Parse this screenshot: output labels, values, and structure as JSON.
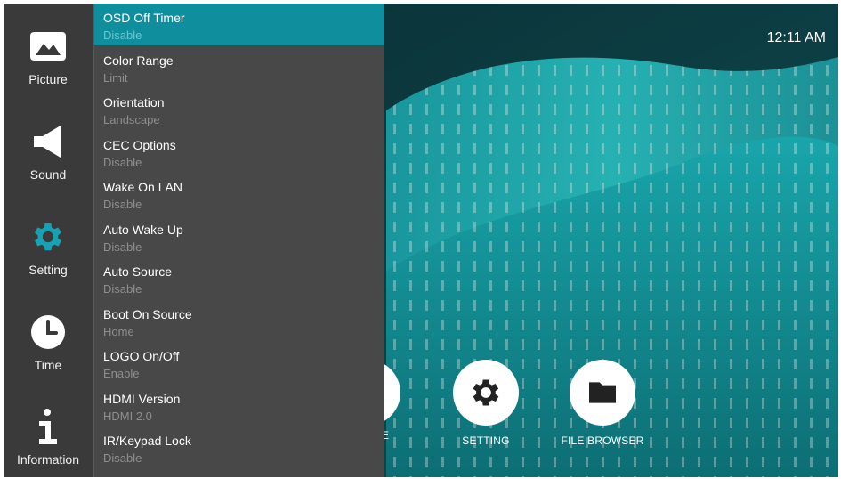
{
  "rail": {
    "items": [
      {
        "label": "Picture",
        "icon": "picture-icon"
      },
      {
        "label": "Sound",
        "icon": "speaker-icon"
      },
      {
        "label": "Setting",
        "icon": "gear-icon",
        "active": true
      },
      {
        "label": "Time",
        "icon": "clock-icon"
      },
      {
        "label": "Information",
        "icon": "info-icon"
      }
    ]
  },
  "settings": {
    "items": [
      {
        "title": "OSD Off Timer",
        "value": "Disable",
        "selected": true
      },
      {
        "title": "Color Range",
        "value": "Limit"
      },
      {
        "title": "Orientation",
        "value": "Landscape"
      },
      {
        "title": "CEC Options",
        "value": "Disable"
      },
      {
        "title": "Wake On LAN",
        "value": "Disable"
      },
      {
        "title": "Auto Wake Up",
        "value": "Disable"
      },
      {
        "title": "Auto Source",
        "value": "Disable"
      },
      {
        "title": "Boot On Source",
        "value": "Home"
      },
      {
        "title": "LOGO On/Off",
        "value": "Enable"
      },
      {
        "title": "HDMI Version",
        "value": "HDMI 2.0"
      },
      {
        "title": "IR/Keypad Lock",
        "value": "Disable"
      }
    ]
  },
  "status": {
    "time": "12:11 AM"
  },
  "apps": [
    {
      "label": "E",
      "icon": "app-icon",
      "partial": true
    },
    {
      "label": "SETTING",
      "icon": "gear-icon"
    },
    {
      "label": "FILE BROWSER",
      "icon": "folder-icon"
    }
  ],
  "colors": {
    "accent": "#0f8f9e",
    "rail_bg": "#3a3a3a",
    "list_bg": "#484848",
    "active_icon": "#17a2b3"
  }
}
